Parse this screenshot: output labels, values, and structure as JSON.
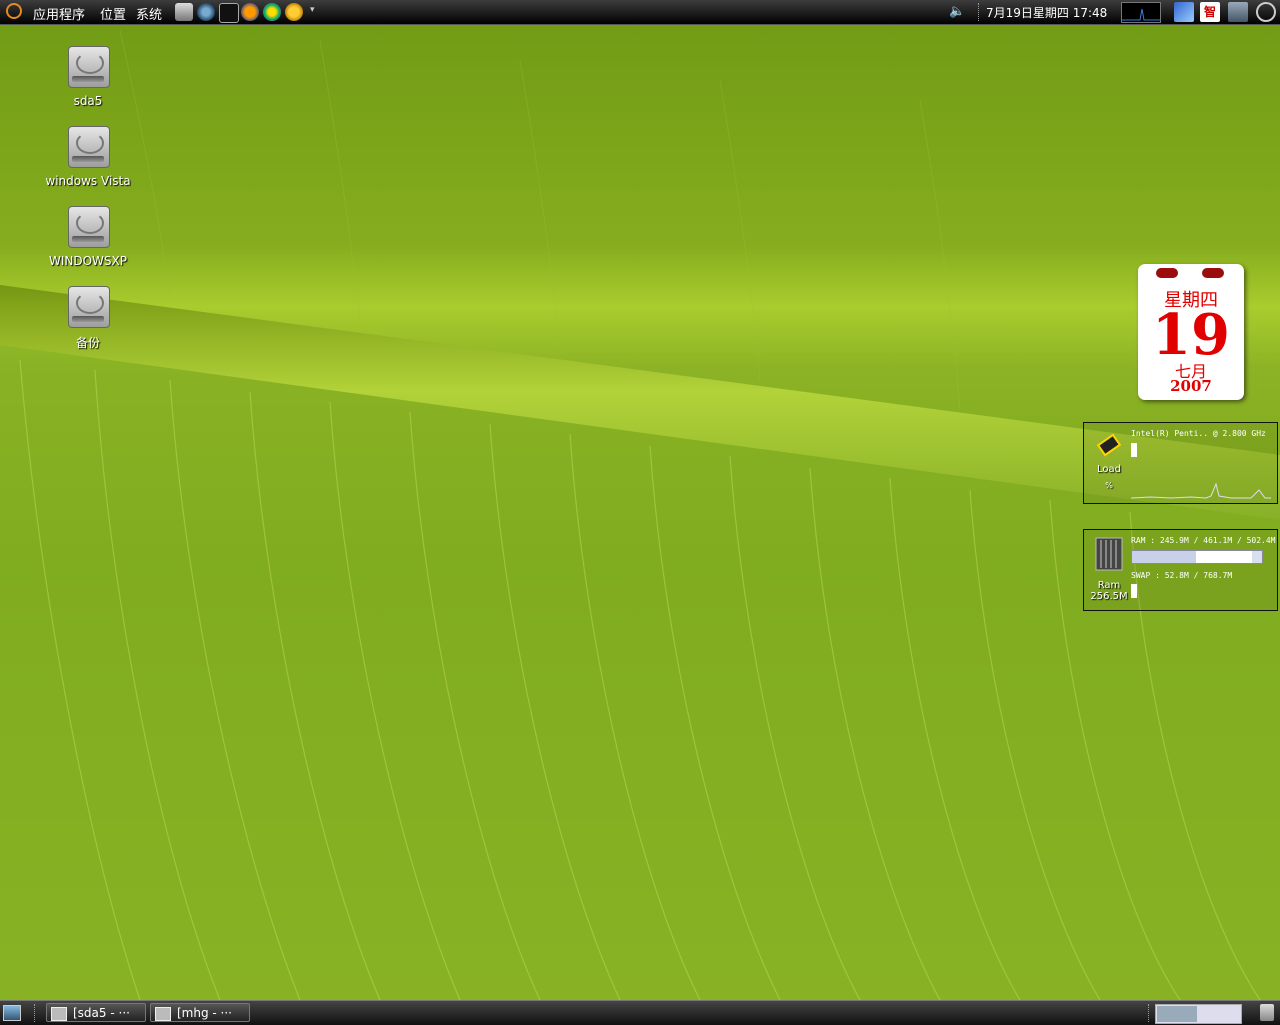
{
  "top_panel": {
    "menu": [
      "应用程序",
      "位置",
      "系统"
    ],
    "clock": "7月19日星期四 17:48",
    "input_method": "智",
    "colors": {
      "panel": "#1c1c1c",
      "ubuntu_orange": "#e58a22"
    }
  },
  "desktop_icons": [
    {
      "label": "sda5",
      "icon": "harddisk-icon"
    },
    {
      "label": "windows  Vista",
      "icon": "harddisk-icon"
    },
    {
      "label": "WINDOWSXP",
      "icon": "harddisk-icon"
    },
    {
      "label": "备份",
      "icon": "harddisk-icon"
    }
  ],
  "calendar": {
    "weekday": "星期四",
    "day": "19",
    "month": "七月",
    "year": "2007"
  },
  "cpu_monitor": {
    "cpu": "Intel(R) Penti.. @ 2.800 GHz",
    "label": "Load",
    "sub": "%"
  },
  "ram_monitor": {
    "ram": "RAM : 245.9M / 461.1M / 502.4M",
    "swap": "SWAP : 52.8M / 768.7M",
    "label": "Ram",
    "value": "256.5M",
    "ram_used_fraction": 0.49,
    "ram_cached_fraction": 0.92
  },
  "taskbar": {
    "tasks": [
      "[sda5 - ···",
      "[mhg - ···"
    ]
  }
}
